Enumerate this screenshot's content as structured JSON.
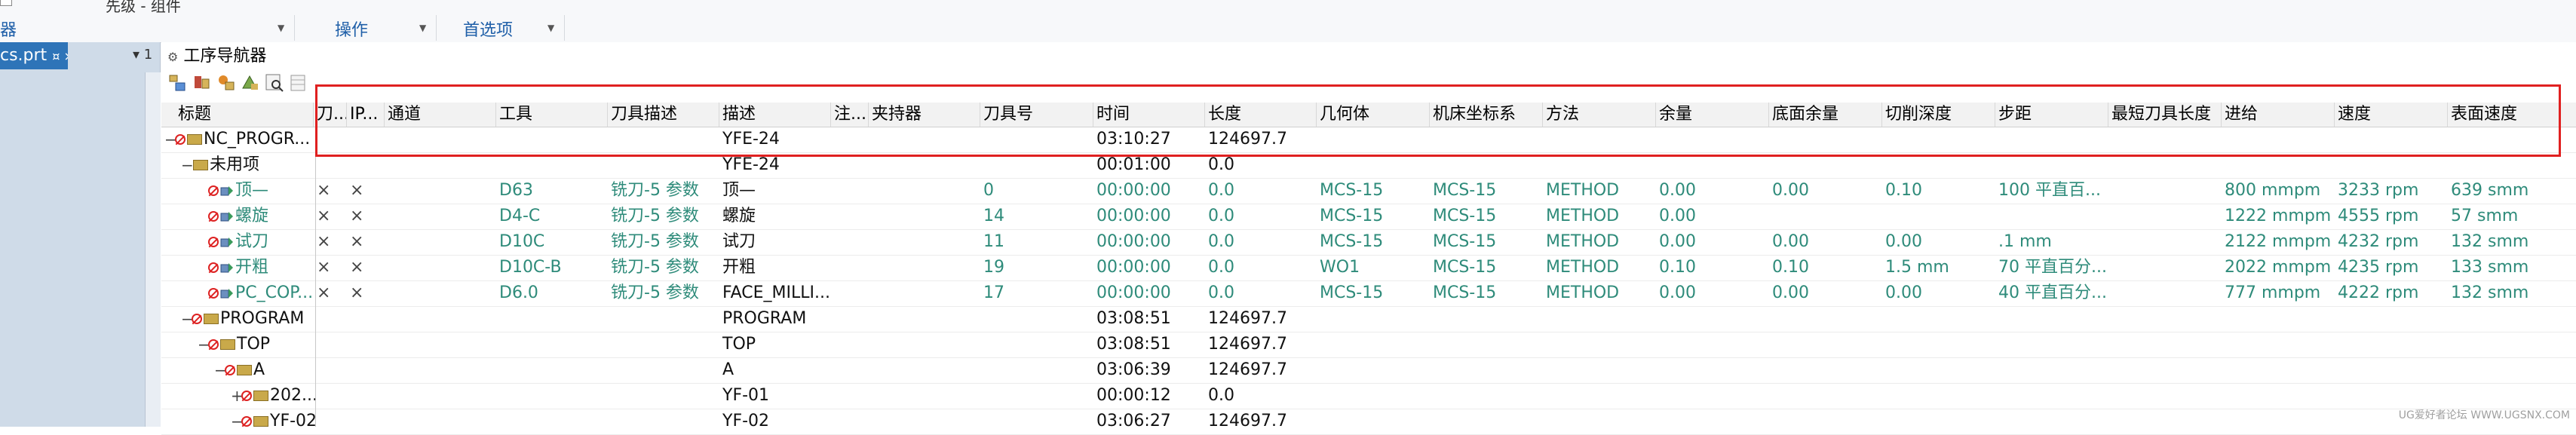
{
  "ribbon": {
    "top_label": "先级 - 组件",
    "left_label": "器",
    "groups": [
      "操作",
      "首选项"
    ]
  },
  "left_panel": {
    "doc_tab": "cs.prt",
    "tab_marks": "¤ ×",
    "counter": "▾ 1"
  },
  "navigator": {
    "title": "工序导航器",
    "columns": [
      "标题",
      "刀...",
      "IP...",
      "通道",
      "工具",
      "刀具描述",
      "描述",
      "注...",
      "夹持器",
      "刀具号",
      "时间",
      "长度",
      "几何体",
      "机床坐标系",
      "方法",
      "余量",
      "底面余量",
      "切削深度",
      "步距",
      "最短刀具长度",
      "进给",
      "速度",
      "表面速度"
    ],
    "rows": [
      {
        "title": "NC_PROGR...",
        "indent": 0,
        "exp": "−",
        "icon": "fold",
        "teal": false,
        "c1": "",
        "c2": "",
        "tool": "",
        "tooldesc": "",
        "desc": "YFE-24",
        "toolno": "",
        "time": "03:10:27",
        "length": "124697.7",
        "geom": "",
        "mcs": "",
        "method": "",
        "stock": "",
        "floor": "",
        "depth": "",
        "step": "",
        "feed": "",
        "speed": "",
        "sfm": ""
      },
      {
        "title": "未用项",
        "indent": 1,
        "exp": "−",
        "icon": "plain-fold",
        "teal": false,
        "c1": "",
        "c2": "",
        "tool": "",
        "tooldesc": "",
        "desc": "YFE-24",
        "toolno": "",
        "time": "00:01:00",
        "length": "0.0",
        "geom": "",
        "mcs": "",
        "method": "",
        "stock": "",
        "floor": "",
        "depth": "",
        "step": "",
        "feed": "",
        "speed": "",
        "sfm": ""
      },
      {
        "title": "顶—",
        "indent": 2,
        "exp": "",
        "icon": "op",
        "teal": true,
        "c1": "×",
        "c2": "×",
        "tool": "D63",
        "tooldesc": "铣刀-5 参数",
        "desc": "顶—",
        "toolno": "0",
        "time": "00:00:00",
        "length": "0.0",
        "geom": "MCS-15",
        "mcs": "MCS-15",
        "method": "METHOD",
        "stock": "0.00",
        "floor": "0.00",
        "depth": "0.10",
        "step": "100 平直百...",
        "feed": "800 mmpm",
        "speed": "3233 rpm",
        "sfm": "639 smm"
      },
      {
        "title": "螺旋",
        "indent": 2,
        "exp": "",
        "icon": "op",
        "teal": true,
        "c1": "×",
        "c2": "×",
        "tool": "D4-C",
        "tooldesc": "铣刀-5 参数",
        "desc": "螺旋",
        "toolno": "14",
        "time": "00:00:00",
        "length": "0.0",
        "geom": "MCS-15",
        "mcs": "MCS-15",
        "method": "METHOD",
        "stock": "0.00",
        "floor": "",
        "depth": "",
        "step": "",
        "feed": "1222 mmpm",
        "speed": "4555 rpm",
        "sfm": "57 smm"
      },
      {
        "title": "试刀",
        "indent": 2,
        "exp": "",
        "icon": "op",
        "teal": true,
        "c1": "×",
        "c2": "×",
        "tool": "D10C",
        "tooldesc": "铣刀-5 参数",
        "desc": "试刀",
        "toolno": "11",
        "time": "00:00:00",
        "length": "0.0",
        "geom": "MCS-15",
        "mcs": "MCS-15",
        "method": "METHOD",
        "stock": "0.00",
        "floor": "0.00",
        "depth": "0.00",
        "step": ".1 mm",
        "feed": "2122 mmpm",
        "speed": "4232 rpm",
        "sfm": "132 smm"
      },
      {
        "title": "开粗",
        "indent": 2,
        "exp": "",
        "icon": "op",
        "teal": true,
        "c1": "×",
        "c2": "×",
        "tool": "D10C-B",
        "tooldesc": "铣刀-5 参数",
        "desc": "开粗",
        "toolno": "19",
        "time": "00:00:00",
        "length": "0.0",
        "geom": "WO1",
        "mcs": "MCS-15",
        "method": "METHOD",
        "stock": "0.10",
        "floor": "0.10",
        "depth": "1.5 mm",
        "step": "70 平直百分...",
        "feed": "2022 mmpm",
        "speed": "4235 rpm",
        "sfm": "133 smm"
      },
      {
        "title": "PC_COP...",
        "indent": 2,
        "exp": "",
        "icon": "op",
        "teal": true,
        "c1": "×",
        "c2": "×",
        "tool": "D6.0",
        "tooldesc": "铣刀-5 参数",
        "desc": "FACE_MILLI...",
        "toolno": "17",
        "time": "00:00:00",
        "length": "0.0",
        "geom": "MCS-15",
        "mcs": "MCS-15",
        "method": "METHOD",
        "stock": "0.00",
        "floor": "0.00",
        "depth": "0.00",
        "step": "40 平直百分...",
        "feed": "777 mmpm",
        "speed": "4222 rpm",
        "sfm": "132 smm"
      },
      {
        "title": "PROGRAM",
        "indent": 1,
        "exp": "−",
        "icon": "fold",
        "teal": false,
        "c1": "",
        "c2": "",
        "tool": "",
        "tooldesc": "",
        "desc": "PROGRAM",
        "toolno": "",
        "time": "03:08:51",
        "length": "124697.7",
        "geom": "",
        "mcs": "",
        "method": "",
        "stock": "",
        "floor": "",
        "depth": "",
        "step": "",
        "feed": "",
        "speed": "",
        "sfm": ""
      },
      {
        "title": "TOP",
        "indent": 2,
        "exp": "−",
        "icon": "fold",
        "teal": false,
        "c1": "",
        "c2": "",
        "tool": "",
        "tooldesc": "",
        "desc": "TOP",
        "toolno": "",
        "time": "03:08:51",
        "length": "124697.7",
        "geom": "",
        "mcs": "",
        "method": "",
        "stock": "",
        "floor": "",
        "depth": "",
        "step": "",
        "feed": "",
        "speed": "",
        "sfm": ""
      },
      {
        "title": "A",
        "indent": 3,
        "exp": "−",
        "icon": "fold",
        "teal": false,
        "c1": "",
        "c2": "",
        "tool": "",
        "tooldesc": "",
        "desc": "A",
        "toolno": "",
        "time": "03:06:39",
        "length": "124697.7",
        "geom": "",
        "mcs": "",
        "method": "",
        "stock": "",
        "floor": "",
        "depth": "",
        "step": "",
        "feed": "",
        "speed": "",
        "sfm": ""
      },
      {
        "title": "202...",
        "indent": 4,
        "exp": "+",
        "icon": "fold",
        "teal": false,
        "c1": "",
        "c2": "",
        "tool": "",
        "tooldesc": "",
        "desc": "YF-01",
        "toolno": "",
        "time": "00:00:12",
        "length": "0.0",
        "geom": "",
        "mcs": "",
        "method": "",
        "stock": "",
        "floor": "",
        "depth": "",
        "step": "",
        "feed": "",
        "speed": "",
        "sfm": ""
      },
      {
        "title": "YF-02",
        "indent": 4,
        "exp": "−",
        "icon": "fold",
        "teal": false,
        "c1": "",
        "c2": "",
        "tool": "",
        "tooldesc": "",
        "desc": "YF-02",
        "toolno": "",
        "time": "03:06:27",
        "length": "124697.7",
        "geom": "",
        "mcs": "",
        "method": "",
        "stock": "",
        "floor": "",
        "depth": "",
        "step": "",
        "feed": "",
        "speed": "",
        "sfm": ""
      }
    ]
  },
  "watermark": "UG爱好者论坛 WWW.UGSNX.COM",
  "colors": {
    "accent": "#2e74b8",
    "teal_text": "#2e8b7a",
    "highlight_box": "#e02020"
  }
}
